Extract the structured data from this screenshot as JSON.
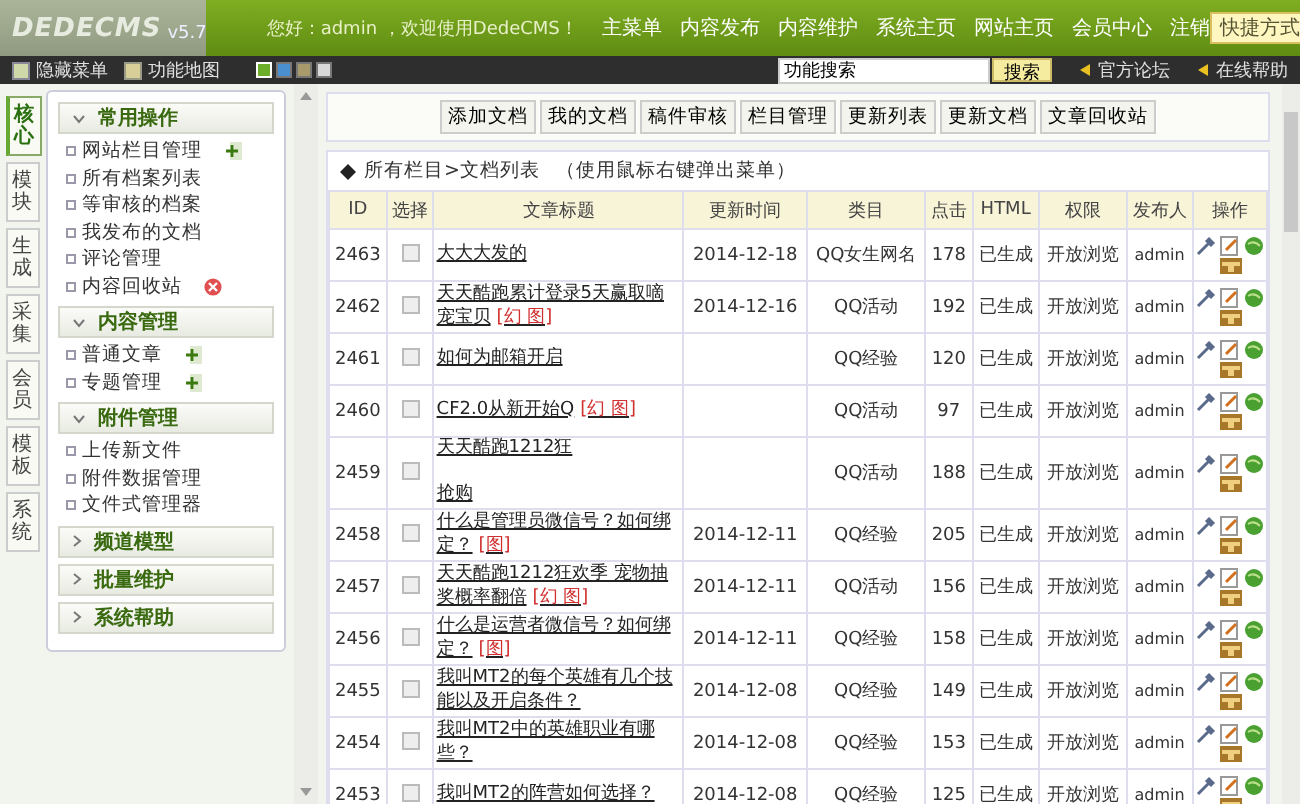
{
  "logo": {
    "name": "DEDECMS",
    "version": "v5.7"
  },
  "top_nav": {
    "greeting": "您好：admin ，欢迎使用DedeCMS！",
    "items": [
      "主菜单",
      "内容发布",
      "内容维护",
      "系统主页",
      "网站主页",
      "会员中心",
      "注销"
    ],
    "shortcut": "快捷方式"
  },
  "sub_bar": {
    "hide_menu": "隐藏菜单",
    "site_map": "功能地图",
    "themes": [
      {
        "color": "#6cae2a",
        "selected": true
      },
      {
        "color": "#4a8fd0",
        "selected": false
      },
      {
        "color": "#a89a6a",
        "selected": false
      },
      {
        "color": "#d8d8d8",
        "selected": false
      }
    ],
    "search": {
      "value": "功能搜索",
      "button": "搜索"
    },
    "links": [
      "官方论坛",
      "在线帮助"
    ]
  },
  "side_tabs": [
    {
      "label": "核心",
      "selected": true
    },
    {
      "label": "模块",
      "selected": false
    },
    {
      "label": "生成",
      "selected": false
    },
    {
      "label": "采集",
      "selected": false
    },
    {
      "label": "会员",
      "selected": false
    },
    {
      "label": "模板",
      "selected": false
    },
    {
      "label": "系统",
      "selected": false
    }
  ],
  "sidebar": [
    {
      "title": "常用操作",
      "expanded": true,
      "items": [
        {
          "label": "网站栏目管理",
          "kind": "add"
        },
        {
          "label": "所有档案列表",
          "kind": "plain"
        },
        {
          "label": "等审核的档案",
          "kind": "plain"
        },
        {
          "label": "我发布的文档",
          "kind": "plain"
        },
        {
          "label": "评论管理",
          "kind": "plain"
        },
        {
          "label": "内容回收站",
          "kind": "delete"
        }
      ]
    },
    {
      "title": "内容管理",
      "expanded": true,
      "items": [
        {
          "label": "普通文章",
          "kind": "add"
        },
        {
          "label": "专题管理",
          "kind": "add"
        }
      ]
    },
    {
      "title": "附件管理",
      "expanded": true,
      "items": [
        {
          "label": "上传新文件",
          "kind": "plain"
        },
        {
          "label": "附件数据管理",
          "kind": "plain"
        },
        {
          "label": "文件式管理器",
          "kind": "plain"
        }
      ]
    },
    {
      "title": "频道模型",
      "expanded": false
    },
    {
      "title": "批量维护",
      "expanded": false
    },
    {
      "title": "系统帮助",
      "expanded": false
    }
  ],
  "toolbar": [
    "添加文档",
    "我的文档",
    "稿件审核",
    "栏目管理",
    "更新列表",
    "更新文档",
    "文章回收站"
  ],
  "breadcrumb": {
    "path": "所有栏目>文档列表",
    "hint": "（使用鼠标右键弹出菜单）"
  },
  "table": {
    "columns": [
      "ID",
      "选择",
      "文章标题",
      "更新时间",
      "类目",
      "点击",
      "HTML",
      "权限",
      "发布人",
      "操作"
    ],
    "rows": [
      {
        "id": "2463",
        "checked": false,
        "title": "大大大发的",
        "date": "2014-12-18",
        "category": "QQ女生网名",
        "clicks": "178",
        "html": "已生成",
        "access": "开放浏览",
        "author": "admin"
      },
      {
        "id": "2462",
        "checked": false,
        "title": "天天酷跑累计登录5天赢取嘀宠宝贝",
        "tag": "[幻 图]",
        "date": "2014-12-16",
        "category": "QQ活动",
        "clicks": "192",
        "html": "已生成",
        "access": "开放浏览",
        "author": "admin"
      },
      {
        "id": "2461",
        "checked": false,
        "title": "如何为邮箱开启",
        "category": "QQ经验",
        "clicks": "120",
        "html": "已生成",
        "access": "开放浏览",
        "author": "admin"
      },
      {
        "id": "2460",
        "checked": false,
        "title": "CF2.0从新开始Q",
        "tag": "[幻 图]",
        "category": "QQ活动",
        "clicks": "97",
        "html": "已生成",
        "access": "开放浏览",
        "author": "admin"
      },
      {
        "id": "2459",
        "checked": false,
        "title": "天天酷跑1212狂",
        "title_end": "抢购",
        "category": "QQ活动",
        "clicks": "188",
        "html": "已生成",
        "access": "开放浏览",
        "author": "admin"
      },
      {
        "id": "2458",
        "checked": false,
        "title": "什么是管理员微信号？如何绑定？",
        "tag": "[图]",
        "date": "2014-12-11",
        "category": "QQ经验",
        "clicks": "205",
        "html": "已生成",
        "access": "开放浏览",
        "author": "admin"
      },
      {
        "id": "2457",
        "checked": false,
        "title": "天天酷跑1212狂欢季 宠物抽奖概率翻倍",
        "tag": "[幻 图]",
        "date": "2014-12-11",
        "category": "QQ活动",
        "clicks": "156",
        "html": "已生成",
        "access": "开放浏览",
        "author": "admin"
      },
      {
        "id": "2456",
        "checked": false,
        "title": "什么是运营者微信号？如何绑定？",
        "tag": "[图]",
        "date": "2014-12-11",
        "category": "QQ经验",
        "clicks": "158",
        "html": "已生成",
        "access": "开放浏览",
        "author": "admin"
      },
      {
        "id": "2455",
        "checked": false,
        "title": "我叫MT2的每个英雄有几个技能以及开启条件？",
        "date": "2014-12-08",
        "category": "QQ经验",
        "clicks": "149",
        "html": "已生成",
        "access": "开放浏览",
        "author": "admin"
      },
      {
        "id": "2454",
        "checked": false,
        "title": "我叫MT2中的英雄职业有哪些？",
        "date": "2014-12-08",
        "category": "QQ经验",
        "clicks": "153",
        "html": "已生成",
        "access": "开放浏览",
        "author": "admin"
      },
      {
        "id": "2453",
        "checked": false,
        "title": "我叫MT2的阵营如何选择？",
        "date": "2014-12-08",
        "category": "QQ经验",
        "clicks": "125",
        "html": "已生成",
        "access": "开放浏览",
        "author": "admin"
      }
    ]
  }
}
